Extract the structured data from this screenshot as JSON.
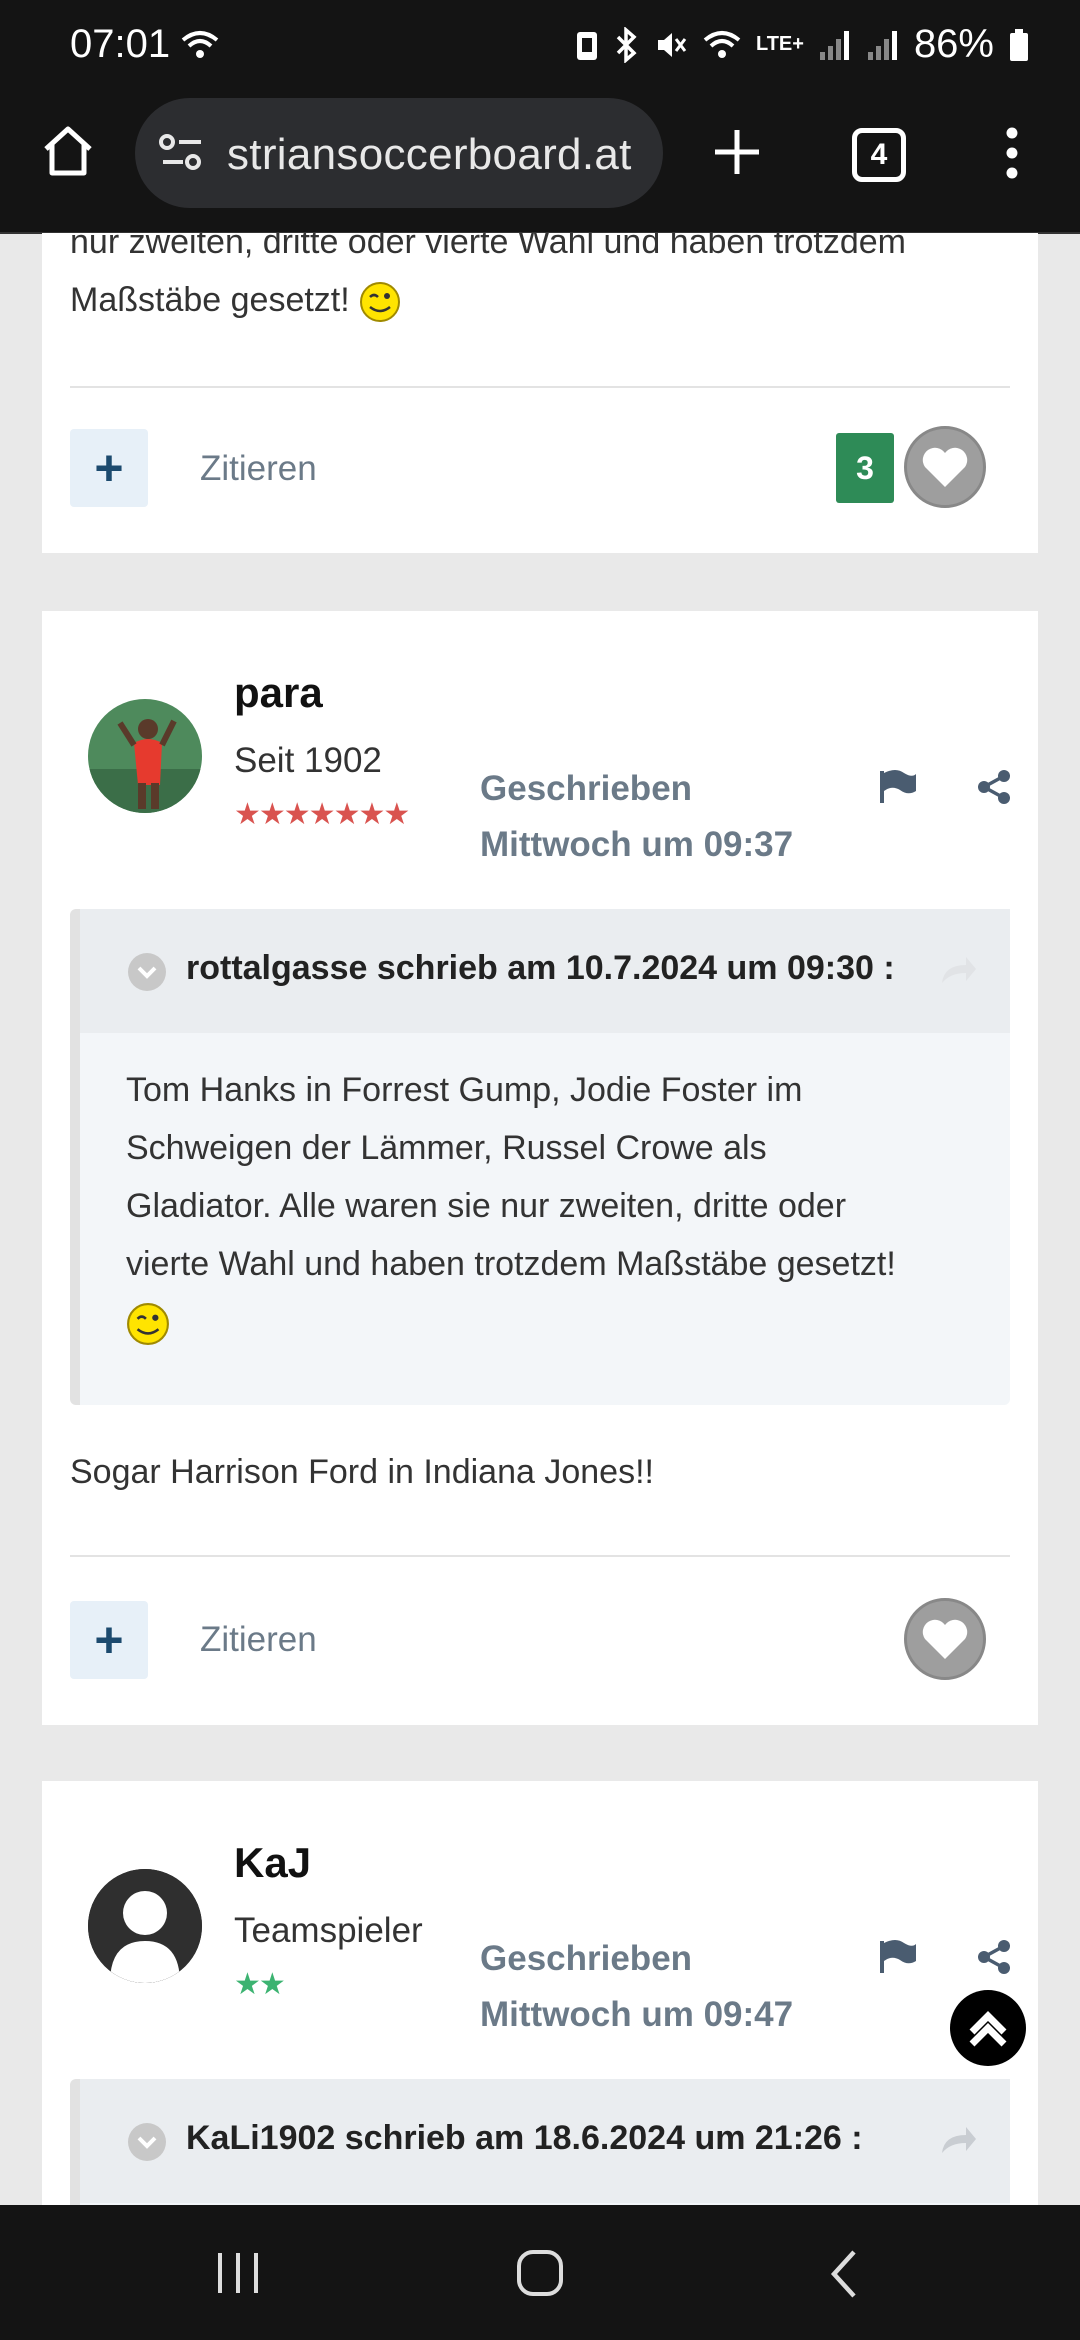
{
  "status_bar": {
    "time": "07:01",
    "battery": "86%",
    "network": "LTE+"
  },
  "browser": {
    "url": "striansoccerboard.at",
    "tab_count": "4"
  },
  "posts": [
    {
      "text_partial_line1": "nur zweiten, dritte oder vierte Wahl und haben trotzdem",
      "text_partial_line2": "Maßstäbe gesetzt!",
      "quote_label": "Zitieren",
      "like_count": "3"
    },
    {
      "username": "para",
      "rank": "Seit 1902",
      "stars": "★★★★★★★",
      "written_label": "Geschrieben",
      "written_time": "Mittwoch um 09:37",
      "quote": {
        "header": "rottalgasse schrieb am 10.7.2024 um 09:30 :",
        "line1": "Tom Hanks in Forrest Gump, Jodie Foster im",
        "line2": "Schweigen der Lämmer, Russel Crowe als",
        "line3": "Gladiator. Alle waren sie nur zweiten, dritte oder",
        "line4": "vierte Wahl und haben trotzdem Maßstäbe gesetzt!"
      },
      "body": "Sogar Harrison Ford in Indiana Jones!!",
      "quote_label": "Zitieren"
    },
    {
      "username": "KaJ",
      "rank": "Teamspieler",
      "stars": "★★",
      "written_label": "Geschrieben",
      "written_time": "Mittwoch um 09:47",
      "quote": {
        "header": "KaLi1902 schrieb am 18.6.2024 um 21:26 :"
      }
    }
  ],
  "colors": {
    "accent_green": "#2e8b57",
    "star_red": "#d9534f",
    "star_green": "#3cb371",
    "meta_gray": "#6b7a88"
  }
}
